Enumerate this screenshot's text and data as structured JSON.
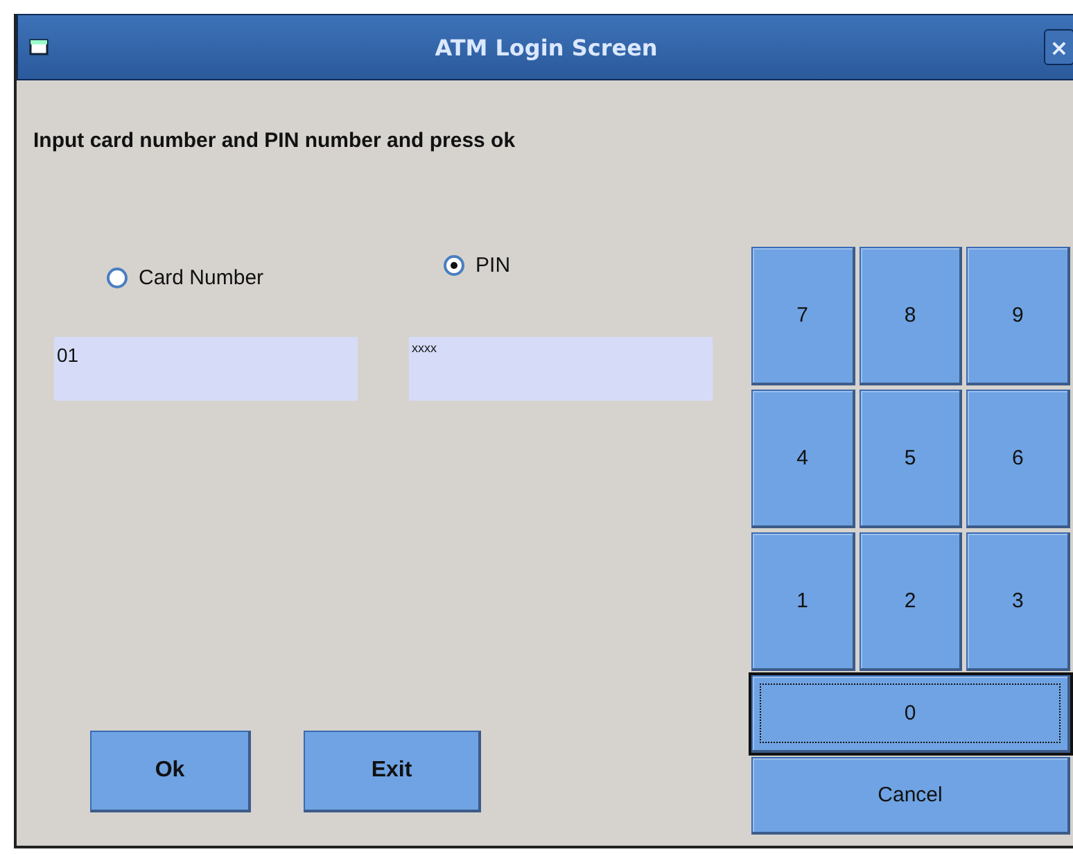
{
  "window": {
    "title": "ATM Login Screen",
    "close": "×"
  },
  "instruction": "Input card number and PIN number and press ok",
  "radios": [
    {
      "label": "Card Number",
      "selected": false
    },
    {
      "label": "PIN",
      "selected": true
    }
  ],
  "fields": [
    {
      "value": "01"
    },
    {
      "value": "xxxx"
    }
  ],
  "buttons": [
    "Ok",
    "Exit"
  ],
  "keypad": {
    "rows": [
      [
        {
          "label": "7",
          "focused": false
        },
        {
          "label": "8",
          "focused": false
        },
        {
          "label": "9",
          "focused": false
        }
      ],
      [
        {
          "label": "4",
          "focused": false
        },
        {
          "label": "5",
          "focused": false
        },
        {
          "label": "6",
          "focused": false
        }
      ],
      [
        {
          "label": "1",
          "focused": false
        },
        {
          "label": "2",
          "focused": false
        },
        {
          "label": "3",
          "focused": false
        }
      ],
      [
        {
          "label": "0",
          "focused": true
        }
      ],
      [
        {
          "label": "Cancel",
          "focused": false
        }
      ]
    ]
  }
}
